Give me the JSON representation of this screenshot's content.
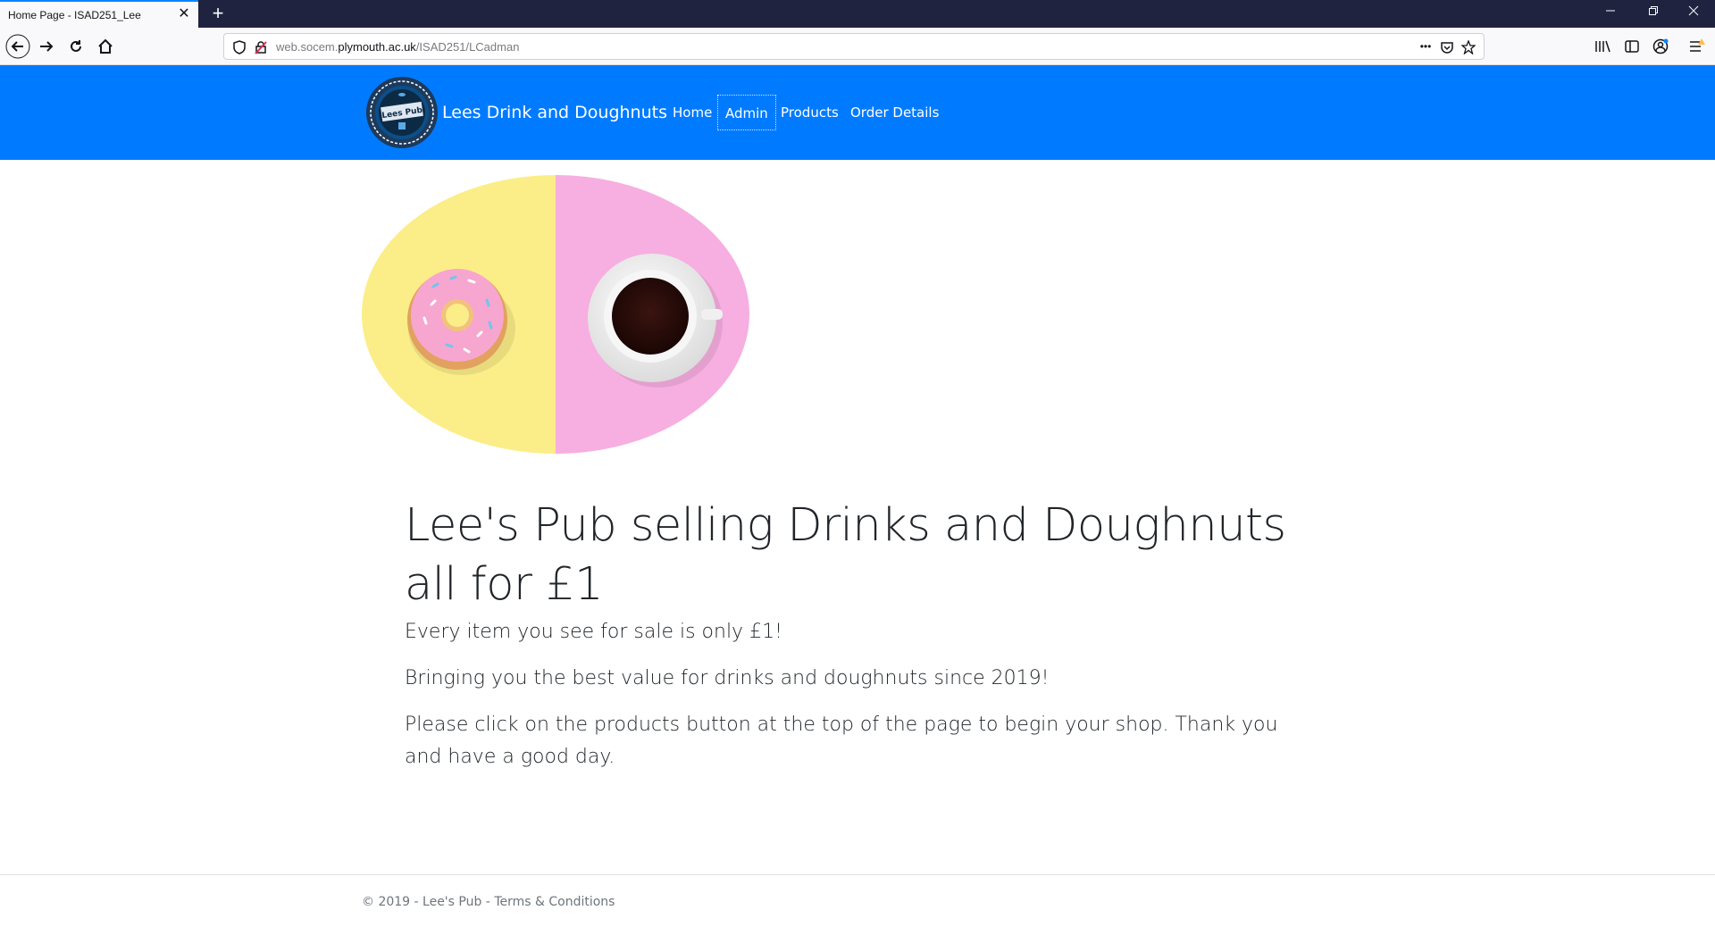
{
  "browser": {
    "tab_title": "Home Page - ISAD251_Lee",
    "tab_close": "✕",
    "new_tab": "+",
    "url_prefix": "web.socem.",
    "url_host": "plymouth.ac.uk",
    "url_path": "/ISAD251/LCadman",
    "page_actions": "•••"
  },
  "site": {
    "logo_text": "Lees Pub",
    "brand": "Lees Drink and Doughnuts",
    "nav": {
      "home": "Home",
      "admin": "Admin",
      "products": "Products",
      "order_details": "Order Details"
    },
    "colors": {
      "navbar": "#007bff",
      "hero_left": "#fbee88",
      "hero_right": "#f7aee0"
    }
  },
  "main": {
    "heading": "Lee's Pub selling Drinks and Doughnuts all for £1",
    "lead1": "Every item you see for sale is only £1!",
    "lead2": "Bringing you the best value for drinks and doughnuts since 2019!",
    "lead3": "Please click on the products button at the top of the page to begin your shop. Thank you and have a good day."
  },
  "footer": {
    "copyright": "© 2019 - Lee's Pub - ",
    "terms": "Terms & Conditions"
  }
}
